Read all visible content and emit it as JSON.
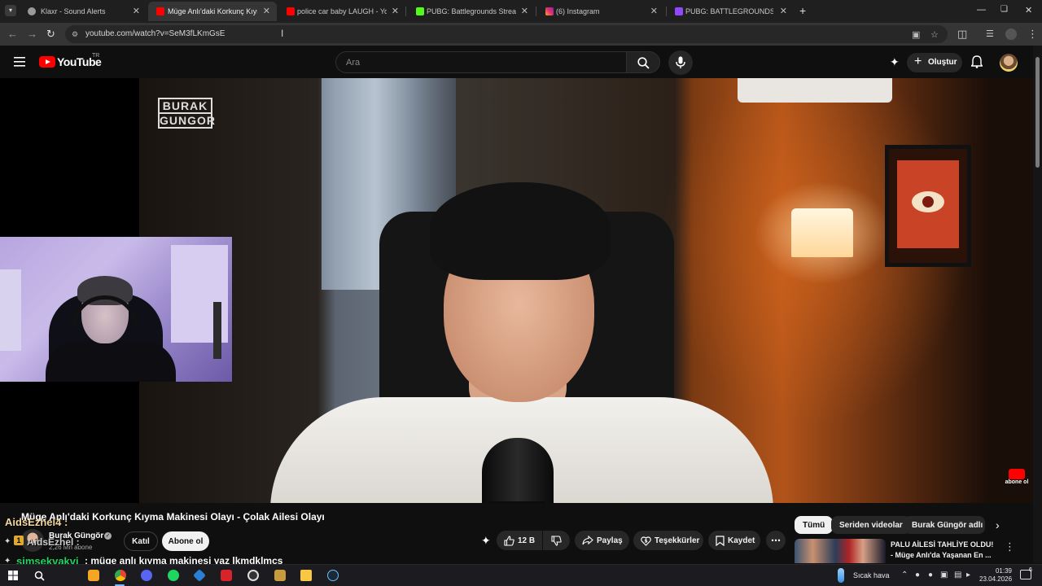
{
  "browser": {
    "tabs": [
      {
        "title": "Klaxr - Sound Alerts",
        "active": false,
        "favicon_color": "#9a9a9a"
      },
      {
        "title": "Müge Anlı'daki Korkunç Kıyma",
        "active": true,
        "favicon_color": "#ff0000"
      },
      {
        "title": "police car baby LAUGH - YouTu",
        "active": false,
        "favicon_color": "#ff0000"
      },
      {
        "title": "PUBG: Battlegrounds Streaming",
        "active": false,
        "favicon_color": "#53fc18"
      },
      {
        "title": "(6) Instagram",
        "active": false,
        "favicon_color": "#e1306c"
      },
      {
        "title": "PUBG: BATTLEGROUNDS - Twit",
        "active": false,
        "favicon_color": "#9146ff"
      }
    ],
    "url": "youtube.com/watch?v=SeM3fLKmGsE"
  },
  "youtube": {
    "logo_text": "YouTube",
    "region": "TR",
    "search_placeholder": "Ara",
    "create_label": "Oluştur"
  },
  "video": {
    "brand_line1": "BURAK",
    "brand_line2": "GUNGOR",
    "title": "Müge Anlı'daki Korkunç Kıyma Makinesi Olayı - Çolak Ailesi Olayı",
    "channel_name": "Burak Güngör",
    "subscribers": "2,26 Mn abone",
    "join_label": "Katıl",
    "subscribe_label": "Abone ol",
    "likes": "12 B",
    "share_label": "Paylaş",
    "thanks_label": "Teşekkürler",
    "save_label": "Kaydet",
    "watermark_text": "abone ol"
  },
  "chat": [
    {
      "user": "AidsEzhel4 :",
      "message": ""
    },
    {
      "user": "AidsEzhel :",
      "message": ""
    },
    {
      "user": "simsekvakvi",
      "message": ": müge anlı kıyma makinesi yaz lkmdklmcs"
    }
  ],
  "sidebar": {
    "chips": [
      "Tümü",
      "Seriden videolar",
      "Burak Güngör adlı yük"
    ],
    "recommendation_title": "PALU AİLESİ TAHLİYE OLDU! - Müge Anlı'da Yaşanan En ..."
  },
  "taskbar": {
    "weather": "Sıcak hava",
    "time": "01:39",
    "date": "23.04.2026",
    "notification_count": "6"
  },
  "colors": {
    "brand_red": "#ff0000",
    "chat_green": "#1ed760",
    "chat_gold": "#f2d7a2"
  }
}
